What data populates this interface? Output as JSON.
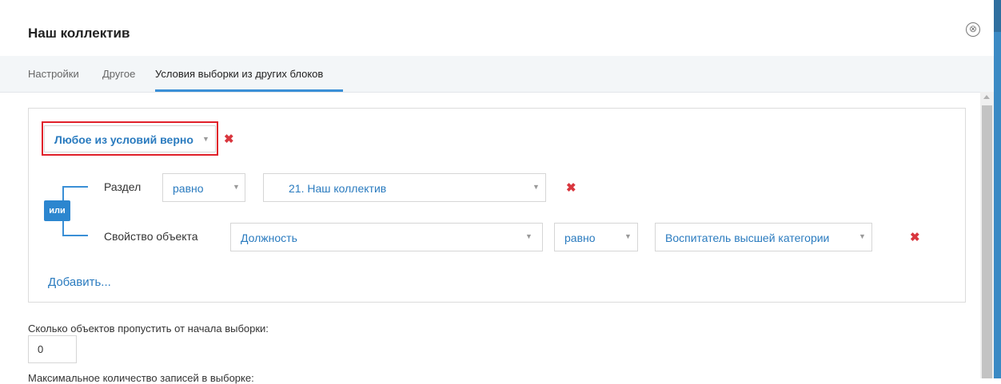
{
  "dialog": {
    "title": "Наш коллектив",
    "close_icon": "⊗"
  },
  "tabs": [
    {
      "label": "Настройки"
    },
    {
      "label": "Другое"
    },
    {
      "label": "Условия выборки из других блоков",
      "active": true
    }
  ],
  "condition_group": {
    "group_mode": "Любое из условий верно",
    "or_badge": "или",
    "delete_icon": "✖",
    "rows": [
      {
        "field_label": "Раздел",
        "operator": "равно",
        "value": "21. Наш коллектив"
      },
      {
        "field_label": "Свойство объекта",
        "property": "Должность",
        "operator": "равно",
        "value": "Воспитатель высшей категории"
      }
    ],
    "add_link": "Добавить..."
  },
  "skip": {
    "label": "Сколько объектов пропустить от начала выборки:",
    "value": "0"
  },
  "max_records": {
    "label": "Максимальное количество записей в выборке:"
  },
  "colors": {
    "accent": "#2a7bbf",
    "delete": "#d9363e",
    "highlight": "#e0202a"
  }
}
